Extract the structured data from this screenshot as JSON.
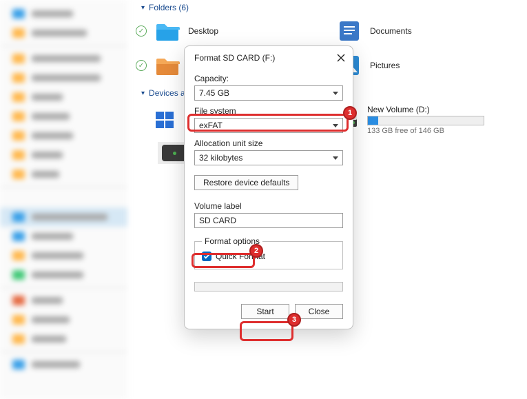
{
  "folders_header": "Folders (6)",
  "devices_header": "Devices and drives",
  "folders": {
    "f0": {
      "name": "Desktop"
    },
    "f1": {
      "name": "Documents"
    },
    "f5": {
      "name": "Pictures"
    }
  },
  "drives": {
    "d1": {
      "name": "New Volume (D:)",
      "free": "133 GB free of 146 GB",
      "fillpct": 9
    }
  },
  "dialog": {
    "title": "Format SD CARD (F:)",
    "capacity_label": "Capacity:",
    "capacity_value": "7.45 GB",
    "fs_label": "File system",
    "fs_value": "exFAT",
    "aus_label": "Allocation unit size",
    "aus_value": "32 kilobytes",
    "restore_label": "Restore device defaults",
    "vol_label": "Volume label",
    "vol_value": "SD CARD",
    "fmt_legend": "Format options",
    "quick_label": "Quick Format",
    "start_label": "Start",
    "close_label": "Close"
  },
  "annotations": {
    "b1": "1",
    "b2": "2",
    "b3": "3"
  }
}
